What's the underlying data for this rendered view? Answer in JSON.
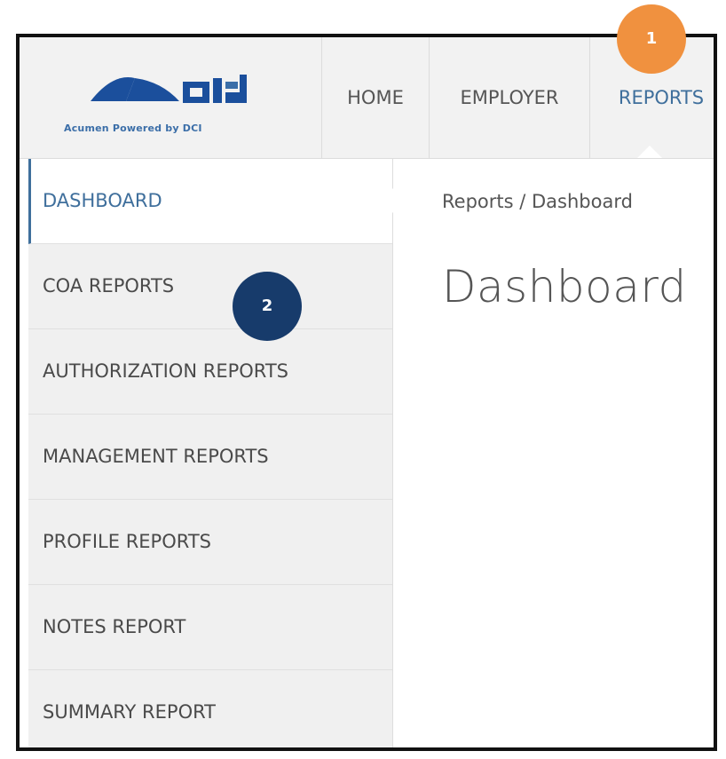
{
  "logo": {
    "tagline": "Acumen Powered by DCI",
    "primary_color": "#1b4f9c",
    "accent_color": "#3b6ea8"
  },
  "nav": {
    "items": [
      {
        "label": "HOME"
      },
      {
        "label": "EMPLOYER"
      },
      {
        "label": "REPORTS",
        "active": true
      }
    ]
  },
  "sidebar": {
    "items": [
      {
        "label": "DASHBOARD",
        "active": true
      },
      {
        "label": "COA REPORTS"
      },
      {
        "label": "AUTHORIZATION REPORTS"
      },
      {
        "label": "MANAGEMENT REPORTS"
      },
      {
        "label": "PROFILE REPORTS"
      },
      {
        "label": "NOTES REPORT"
      },
      {
        "label": "SUMMARY REPORT"
      }
    ]
  },
  "main": {
    "breadcrumb": "Reports / Dashboard",
    "title": "Dashboard"
  },
  "callouts": [
    {
      "label": "1",
      "color": "#f0913f"
    },
    {
      "label": "2",
      "color": "#173b6b"
    }
  ]
}
